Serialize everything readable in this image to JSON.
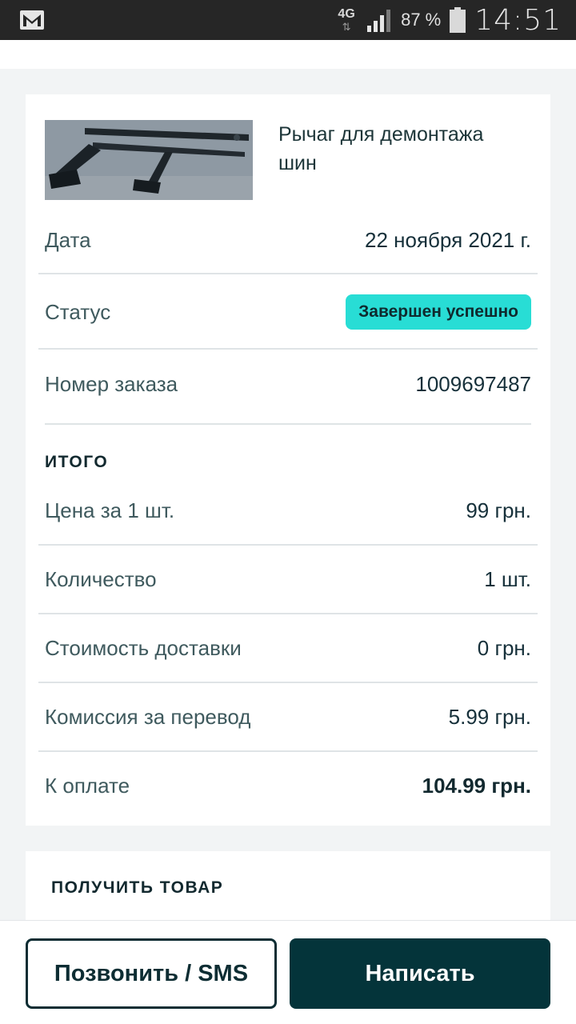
{
  "status_bar": {
    "network": "4G",
    "network_arrows": "⇅",
    "battery_percent": "87 %",
    "time": "14:51"
  },
  "order": {
    "product_title": "Рычаг для демонтажа шин",
    "date_label": "Дата",
    "date_value": "22 ноября 2021 г.",
    "status_label": "Статус",
    "status_value": "Завершен успешно",
    "status_color": "#28ddd5",
    "order_number_label": "Номер заказа",
    "order_number_value": "1009697487"
  },
  "total": {
    "title": "ИТОГО",
    "price_label": "Цена за 1 шт.",
    "price_value": "99 грн.",
    "qty_label": "Количество",
    "qty_value": "1 шт.",
    "delivery_label": "Стоимость доставки",
    "delivery_value": "0 грн.",
    "commission_label": "Комиссия за перевод",
    "commission_value": "5.99 грн.",
    "pay_label": "К оплате",
    "pay_value": "104.99 грн."
  },
  "receive": {
    "title": "ПОЛУЧИТЬ ТОВАР"
  },
  "actions": {
    "call_label": "Позвонить / SMS",
    "write_label": "Написать",
    "primary_color": "#04343a"
  }
}
